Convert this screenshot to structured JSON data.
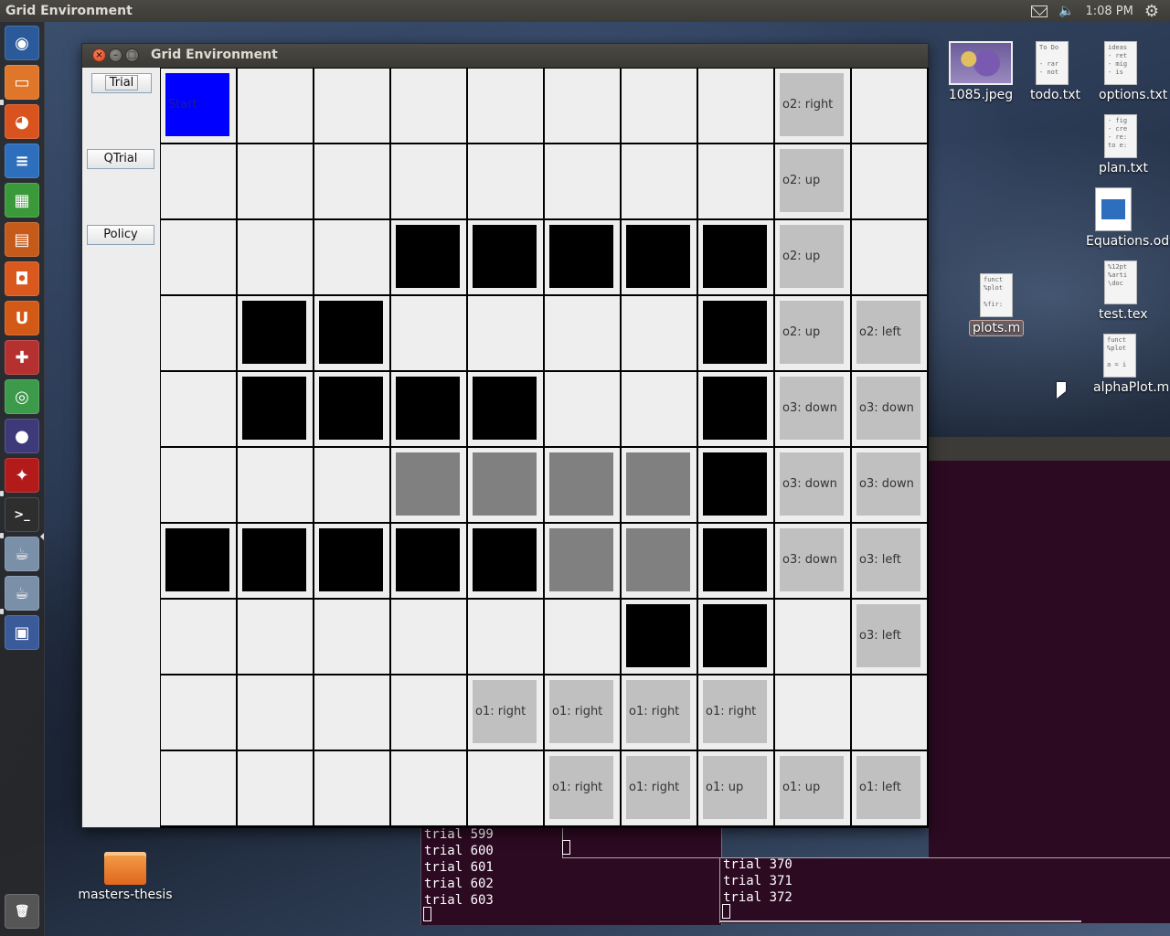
{
  "top_panel": {
    "app_title": "Grid Environment",
    "clock": "1:08 PM",
    "icons": [
      "mail-icon",
      "volume-icon",
      "gear-icon"
    ]
  },
  "launcher": {
    "items": [
      {
        "name": "dash-icon",
        "glyph": "◉",
        "color": "#2a5a9a"
      },
      {
        "name": "files-icon",
        "glyph": "▭",
        "color": "#e0762a"
      },
      {
        "name": "firefox-icon",
        "glyph": "◕",
        "color": "#d9531e"
      },
      {
        "name": "writer-icon",
        "glyph": "≡",
        "color": "#2d6fbc"
      },
      {
        "name": "calc-icon",
        "glyph": "▦",
        "color": "#3a9a3a"
      },
      {
        "name": "impress-icon",
        "glyph": "▤",
        "color": "#c55a1a"
      },
      {
        "name": "software-center-icon",
        "glyph": "◘",
        "color": "#d8581e"
      },
      {
        "name": "ubuntu-one-icon",
        "glyph": "U",
        "color": "#d35a16"
      },
      {
        "name": "settings-icon",
        "glyph": "✚",
        "color": "#b5312f"
      },
      {
        "name": "chrome-icon",
        "glyph": "◎",
        "color": "#3c9a4a"
      },
      {
        "name": "eclipse-icon",
        "glyph": "●",
        "color": "#3e3a7a"
      },
      {
        "name": "acrobat-icon",
        "glyph": "✦",
        "color": "#b31b1b"
      },
      {
        "name": "terminal-icon",
        "glyph": ">_",
        "color": "#2e2e2e"
      },
      {
        "name": "java-app-icon",
        "glyph": "☕",
        "color": "#7a8fa8"
      },
      {
        "name": "java-app-2-icon",
        "glyph": "☕",
        "color": "#7a8fa8"
      },
      {
        "name": "workspace-switcher-icon",
        "glyph": "▣",
        "color": "#3a5a9a"
      },
      {
        "name": "trash-icon",
        "glyph": "🗑",
        "color": "#555"
      }
    ]
  },
  "desktop": {
    "icons": [
      {
        "name": "image-file-icon",
        "label": "1085.jpeg",
        "thumb": "",
        "kind": "image"
      },
      {
        "name": "todo-file-icon",
        "label": "todo.txt",
        "thumb": "To Do\n\n- rar\n- not",
        "kind": "doc"
      },
      {
        "name": "options-file-icon",
        "label": "options.txt",
        "thumb": "ideas\n- ret\n- mig\n- is",
        "kind": "doc"
      },
      {
        "name": "plan-file-icon",
        "label": "plan.txt",
        "thumb": "- fig\n- cre\n- re:\nto e:",
        "kind": "doc"
      },
      {
        "name": "equations-file-icon",
        "label": "Equations.odt",
        "thumb": "",
        "kind": "odt"
      },
      {
        "name": "plots-file-icon",
        "label": "plots.m",
        "thumb": "funct\n%plot\n\n%fir:",
        "kind": "doc"
      },
      {
        "name": "test-tex-file-icon",
        "label": "test.tex",
        "thumb": "%12pt\n%arti\n\\doc",
        "kind": "doc"
      },
      {
        "name": "alphaplot-file-icon",
        "label": "alphaPlot.m",
        "thumb": "funct\n%plot\n\na = i",
        "kind": "doc"
      },
      {
        "name": "folder-icon",
        "label": "masters-thesis",
        "thumb": "",
        "kind": "folder"
      }
    ]
  },
  "terminals": {
    "left": [
      "trial 599",
      "trial 600",
      "trial 601",
      "trial 602",
      "trial 603"
    ],
    "right": [
      "trial 370",
      "trial 371",
      "trial 372"
    ]
  },
  "window": {
    "title": "Grid Environment",
    "buttons": {
      "trial": "Trial",
      "qtrial": "QTrial",
      "policy": "Policy"
    }
  },
  "grid": {
    "rows": 10,
    "cols": 10,
    "legend": {
      "B": "black",
      "G": "gray",
      "L": "light",
      "S": "blue",
      "E": "empty"
    },
    "cells": [
      [
        "S",
        "E",
        "E",
        "E",
        "E",
        "E",
        "E",
        "E",
        "L",
        "E"
      ],
      [
        "E",
        "E",
        "E",
        "E",
        "E",
        "E",
        "E",
        "E",
        "L",
        "E"
      ],
      [
        "E",
        "E",
        "E",
        "B",
        "B",
        "B",
        "B",
        "B",
        "L",
        "E"
      ],
      [
        "E",
        "B",
        "B",
        "E",
        "E",
        "E",
        "E",
        "B",
        "L",
        "L"
      ],
      [
        "E",
        "B",
        "B",
        "B",
        "B",
        "E",
        "E",
        "B",
        "L",
        "L"
      ],
      [
        "E",
        "E",
        "E",
        "G",
        "G",
        "G",
        "G",
        "B",
        "L",
        "L"
      ],
      [
        "B",
        "B",
        "B",
        "B",
        "B",
        "G",
        "G",
        "B",
        "L",
        "L"
      ],
      [
        "E",
        "E",
        "E",
        "E",
        "E",
        "E",
        "B",
        "B",
        "E",
        "L"
      ],
      [
        "E",
        "E",
        "E",
        "E",
        "L",
        "L",
        "L",
        "L",
        "E",
        "E"
      ],
      [
        "E",
        "E",
        "E",
        "E",
        "E",
        "L",
        "L",
        "L",
        "L",
        "L"
      ]
    ],
    "labels": [
      [
        "Start",
        "",
        "",
        "",
        "",
        "",
        "",
        "",
        "o2: right",
        ""
      ],
      [
        "",
        "",
        "",
        "",
        "",
        "",
        "",
        "",
        "o2: up",
        ""
      ],
      [
        "",
        "",
        "",
        "",
        "",
        "",
        "",
        "",
        "o2: up",
        ""
      ],
      [
        "",
        "",
        "",
        "",
        "",
        "",
        "",
        "",
        "o2: up",
        "o2: left"
      ],
      [
        "",
        "",
        "",
        "",
        "",
        "",
        "",
        "",
        "o3: down",
        "o3: down"
      ],
      [
        "",
        "",
        "",
        "",
        "",
        "",
        "",
        "",
        "o3: down",
        "o3: down"
      ],
      [
        "",
        "",
        "",
        "",
        "",
        "",
        "",
        "",
        "o3: down",
        "o3: left"
      ],
      [
        "",
        "",
        "",
        "",
        "",
        "",
        "",
        "",
        "",
        "o3: left"
      ],
      [
        "",
        "",
        "",
        "",
        "o1: right",
        "o1: right",
        "o1: right",
        "o1: right",
        "",
        ""
      ],
      [
        "",
        "",
        "",
        "",
        "",
        "o1: right",
        "o1: right",
        "o1: up",
        "o1: up",
        "o1: left"
      ]
    ]
  }
}
